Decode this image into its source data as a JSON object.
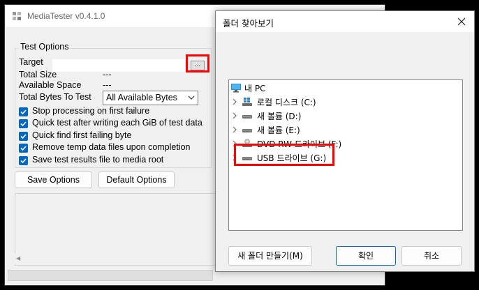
{
  "main_window": {
    "title": "MediaTester v0.4.1.0",
    "options_group_title": "Test Options",
    "target_label": "Target",
    "target_value": "",
    "browse_label": "...",
    "total_size_label": "Total Size",
    "total_size_value": "---",
    "available_space_label": "Available Space",
    "available_space_value": "---",
    "total_bytes_label": "Total Bytes To Test",
    "total_bytes_selected": "All Available Bytes",
    "checkboxes": [
      {
        "label": "Stop processing on first failure",
        "checked": true
      },
      {
        "label": "Quick test after writing each GiB of test data",
        "checked": true
      },
      {
        "label": "Quick find first failing byte",
        "checked": true
      },
      {
        "label": "Remove temp data files upon completion",
        "checked": true
      },
      {
        "label": "Save test results file to media root",
        "checked": true
      }
    ],
    "save_options_label": "Save Options",
    "default_options_label": "Default Options"
  },
  "folder_dialog": {
    "title": "폴더 찾아보기",
    "tree": [
      {
        "label": "내 PC",
        "icon": "pc-icon"
      },
      {
        "label": "로컬 디스크 (C:)",
        "icon": "windows-drive-icon"
      },
      {
        "label": "새 볼륨 (D:)",
        "icon": "drive-icon"
      },
      {
        "label": "새 볼륨 (E:)",
        "icon": "drive-icon"
      },
      {
        "label": "DVD RW 드라이브 (F:)",
        "icon": "dvd-drive-icon"
      },
      {
        "label": "USB 드라이브 (G:)",
        "icon": "usb-drive-icon",
        "selected": true
      }
    ],
    "new_folder_label": "새 폴더 만들기(M)",
    "ok_label": "확인",
    "cancel_label": "취소"
  },
  "colors": {
    "accent": "#0067c0",
    "highlight": "#ff0000"
  }
}
